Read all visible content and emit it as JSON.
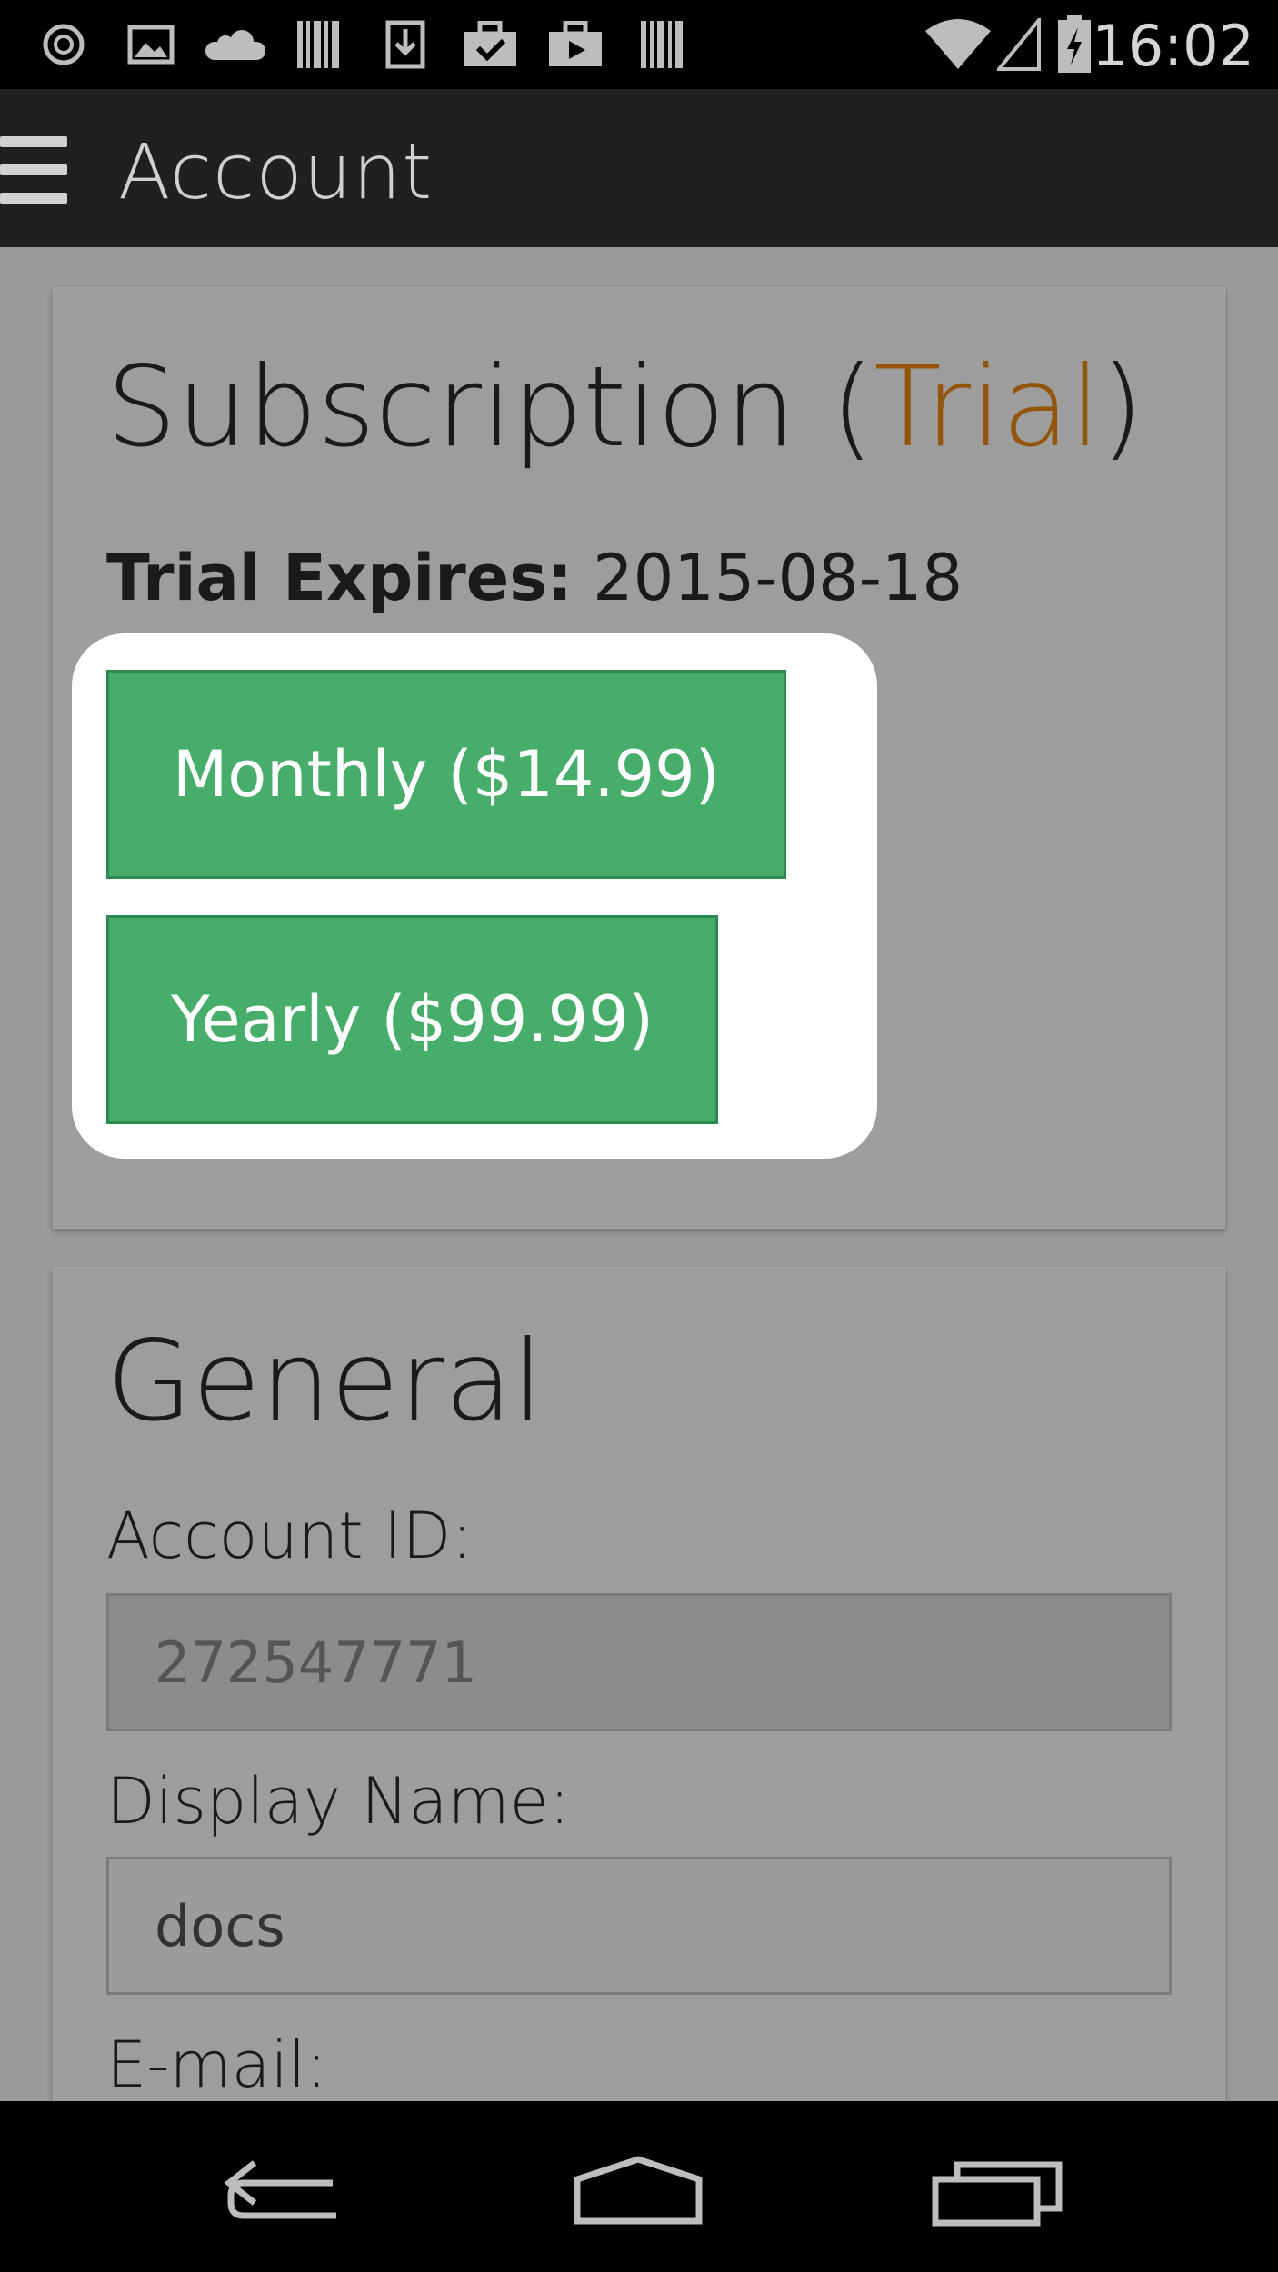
{
  "status_bar": {
    "time": "16:02",
    "icons": [
      "sync-icon",
      "image-icon",
      "cloud-icon",
      "barcode-icon",
      "download-icon",
      "clipboard-check-icon",
      "play-briefcase-icon",
      "barcode-icon",
      "wifi-icon",
      "signal-icon",
      "battery-charging-icon"
    ]
  },
  "action_bar": {
    "title": "Account"
  },
  "subscription": {
    "title_prefix": "Subscription (",
    "title_status": "Trial",
    "title_suffix": ")",
    "expires_label": "Trial Expires:",
    "expires_value": "2015-08-18",
    "monthly_label": "Monthly ($14.99)",
    "yearly_label": "Yearly ($99.99)"
  },
  "general": {
    "title": "General",
    "account_id_label": "Account ID:",
    "account_id_value": "272547771",
    "display_name_label": "Display Name:",
    "display_name_value": "docs",
    "email_label": "E-mail:"
  },
  "nav_bar": {
    "buttons": [
      "back-icon",
      "home-icon",
      "recent-apps-icon"
    ]
  },
  "colors": {
    "trial_accent": "#93550a",
    "plan_button": "#47ad6b",
    "action_bar": "#202020"
  }
}
